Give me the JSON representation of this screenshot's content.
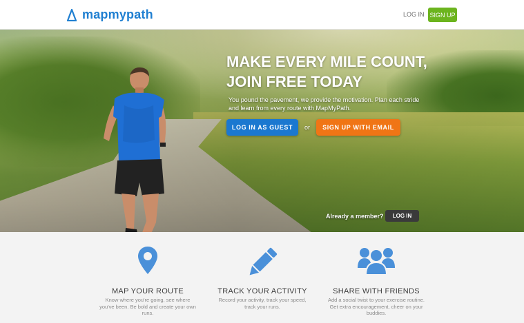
{
  "header": {
    "logo_text": "mapmypath",
    "login_label": "LOG IN",
    "signup_label": "SIGN UP"
  },
  "hero": {
    "title_line1": "MAKE EVERY MILE COUNT,",
    "title_line2": "JOIN FREE TODAY",
    "text_line1": "You pound the pavement, we provide the motivation. Plan each stride",
    "text_line2": "and learn from every route with MapMyPath.",
    "guest_button": "LOG IN AS GUEST",
    "or_label": "or",
    "email_button": "SIGN UP WITH EMAIL",
    "already_member": "Already a member?",
    "login_button": "LOG IN"
  },
  "features": [
    {
      "icon": "map-pin-icon",
      "title": "MAP YOUR ROUTE",
      "text": "Know where you're going, see where you've been. Be bold and create your own runs."
    },
    {
      "icon": "pencil-icon",
      "title": "TRACK YOUR ACTIVITY",
      "text": "Record your activity, track your speed, track your runs."
    },
    {
      "icon": "friends-icon",
      "title": "SHARE WITH FRIENDS",
      "text": "Add a social twist to your exercise routine. Get extra encouragement, cheer on your buddies."
    }
  ],
  "colors": {
    "brand_blue": "#1f7fd1",
    "signup_green": "#6cb41e",
    "guest_blue": "#1b78d0",
    "email_orange": "#f07515",
    "icon_blue": "#4a90d9"
  }
}
